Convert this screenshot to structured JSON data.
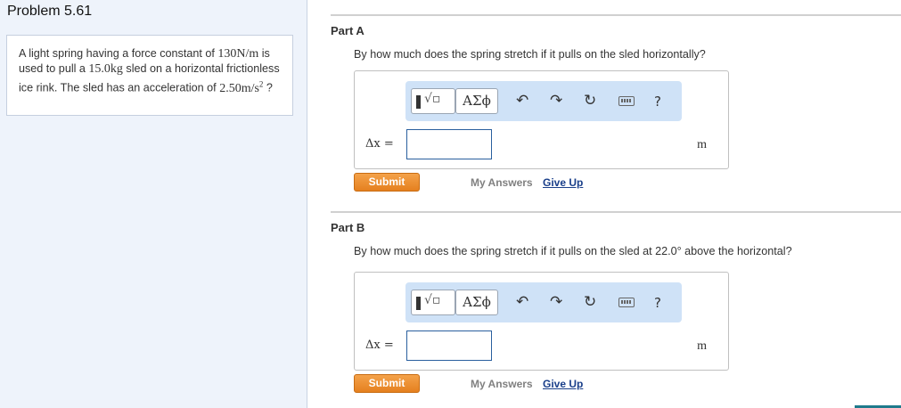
{
  "problem": {
    "title": "Problem 5.61",
    "text_1": "A light spring having a force constant of ",
    "k_value": "130",
    "k_unit": "N/m",
    "text_2": " is used to pull a ",
    "m_value": "15.0",
    "m_unit": "kg",
    "text_3": " sled on a horizontal frictionless ice rink. The sled has an acceleration of ",
    "a_value": "2.50",
    "a_unit": "m/s",
    "a_exp": "2",
    "text_4": " ?"
  },
  "toolbar": {
    "templates_icon": "templates-icon",
    "symbols_label": "ΑΣϕ",
    "undo": "↶",
    "redo": "↷",
    "reset": "↻",
    "keyboard_icon": "keyboard-icon",
    "help": "?"
  },
  "part_a": {
    "label": "Part A",
    "question": "By how much does the spring stretch if it pulls on the sled horizontally?",
    "variable": "Δx =",
    "value": "",
    "unit": "m",
    "submit": "Submit",
    "my_answers": "My Answers",
    "give_up": "Give Up"
  },
  "part_b": {
    "label": "Part B",
    "question": "By how much does the spring stretch if it pulls on the sled at 22.0° above the horizontal?",
    "variable": "Δx =",
    "value": "",
    "unit": "m",
    "submit": "Submit",
    "my_answers": "My Answers",
    "give_up": "Give Up"
  },
  "colors": {
    "panel_bg": "#eef3fb",
    "toolbar_bg": "#cfe2f7",
    "submit_orange": "#e5801f",
    "link_blue": "#1a3f8a"
  }
}
